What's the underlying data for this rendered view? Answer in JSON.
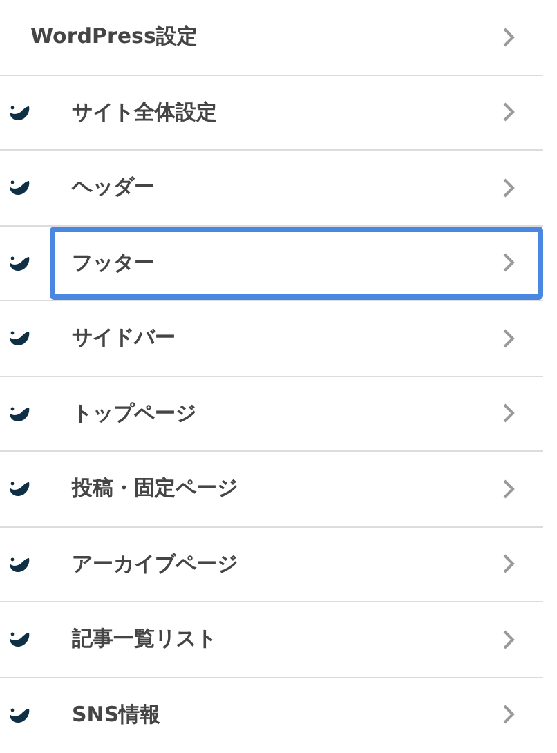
{
  "menu": [
    {
      "label": "WordPress設定",
      "kind": "section",
      "selected": false
    },
    {
      "label": "サイト全体設定",
      "kind": "item",
      "selected": false
    },
    {
      "label": "ヘッダー",
      "kind": "item",
      "selected": false
    },
    {
      "label": "フッター",
      "kind": "item",
      "selected": true
    },
    {
      "label": "サイドバー",
      "kind": "item",
      "selected": false
    },
    {
      "label": "トップページ",
      "kind": "item",
      "selected": false
    },
    {
      "label": "投稿・固定ページ",
      "kind": "item",
      "selected": false
    },
    {
      "label": "アーカイブページ",
      "kind": "item",
      "selected": false
    },
    {
      "label": "記事一覧リスト",
      "kind": "item",
      "selected": false
    },
    {
      "label": "SNS情報",
      "kind": "item",
      "selected": false
    }
  ]
}
